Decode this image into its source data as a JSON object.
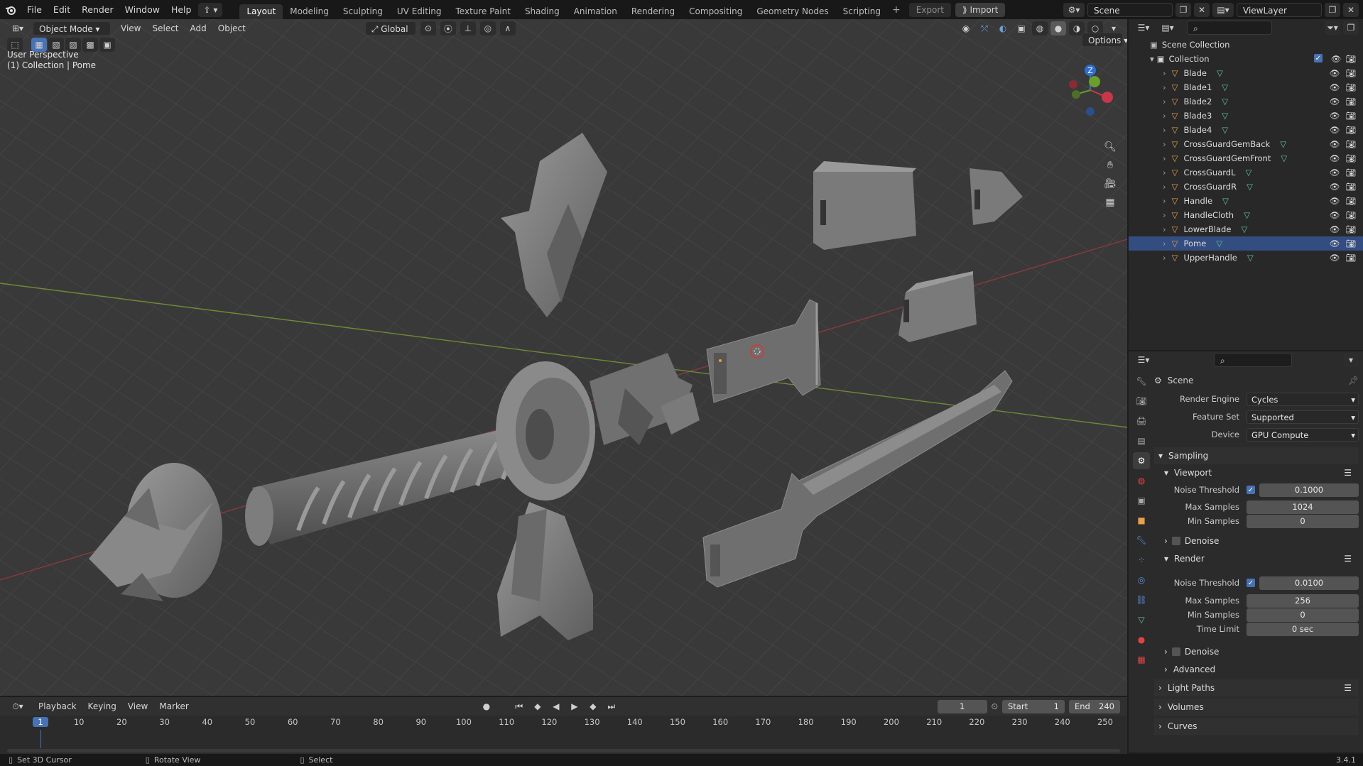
{
  "topbar": {
    "menus": [
      "File",
      "Edit",
      "Render",
      "Window",
      "Help"
    ],
    "workspaces": [
      "Layout",
      "Modeling",
      "Sculpting",
      "UV Editing",
      "Texture Paint",
      "Shading",
      "Animation",
      "Rendering",
      "Compositing",
      "Geometry Nodes",
      "Scripting"
    ],
    "active_workspace": "Layout",
    "export_label": "Export",
    "import_label": "Import",
    "scene_name": "Scene",
    "view_layer": "ViewLayer"
  },
  "viewport": {
    "mode": "Object Mode",
    "menus": [
      "View",
      "Select",
      "Add",
      "Object"
    ],
    "orientation": "Global",
    "options_label": "Options",
    "overlay_title": "User Perspective",
    "overlay_subtitle": "(1) Collection | Pome",
    "gizmo_axis_z": "Z",
    "gizmo_axis_y": "Y",
    "gizmo_axis_x": "X",
    "colors": {
      "background": "#393939",
      "grid": "#464646",
      "x_axis": "#8a3a3a",
      "y_axis": "#6f8a33",
      "mesh": "#7a7a7a"
    }
  },
  "outliner": {
    "root": "Scene Collection",
    "collection": "Collection",
    "objects": [
      "Blade",
      "Blade1",
      "Blade2",
      "Blade3",
      "Blade4",
      "CrossGuardGemBack",
      "CrossGuardGemFront",
      "CrossGuardL",
      "CrossGuardR",
      "Handle",
      "HandleCloth",
      "LowerBlade",
      "Pome",
      "UpperHandle"
    ],
    "selected": "Pome"
  },
  "properties": {
    "context": "Scene",
    "render_engine_label": "Render Engine",
    "render_engine": "Cycles",
    "feature_set_label": "Feature Set",
    "feature_set": "Supported",
    "device_label": "Device",
    "device": "GPU Compute",
    "sampling_label": "Sampling",
    "viewport_label": "Viewport",
    "noise_threshold_label": "Noise Threshold",
    "viewport_noise_threshold": "0.1000",
    "max_samples_label": "Max Samples",
    "viewport_max_samples": "1024",
    "min_samples_label": "Min Samples",
    "viewport_min_samples": "0",
    "denoise_label": "Denoise",
    "render_label": "Render",
    "render_noise_threshold": "0.0100",
    "render_max_samples": "256",
    "render_min_samples": "0",
    "time_limit_label": "Time Limit",
    "time_limit": "0 sec",
    "advanced_label": "Advanced",
    "light_paths_label": "Light Paths",
    "volumes_label": "Volumes",
    "curves_label": "Curves"
  },
  "timeline": {
    "menus": [
      "Playback",
      "Keying",
      "View",
      "Marker"
    ],
    "current_frame": "1",
    "start_label": "Start",
    "start": "1",
    "end_label": "End",
    "end": "240",
    "ruler": [
      "1",
      "10",
      "20",
      "30",
      "40",
      "50",
      "60",
      "70",
      "80",
      "90",
      "100",
      "110",
      "120",
      "130",
      "140",
      "150",
      "160",
      "170",
      "180",
      "190",
      "200",
      "210",
      "220",
      "230",
      "240",
      "250"
    ]
  },
  "status": {
    "left": "Set 3D Cursor",
    "middle": "Rotate View",
    "right": "Select",
    "version": "3.4.1"
  }
}
